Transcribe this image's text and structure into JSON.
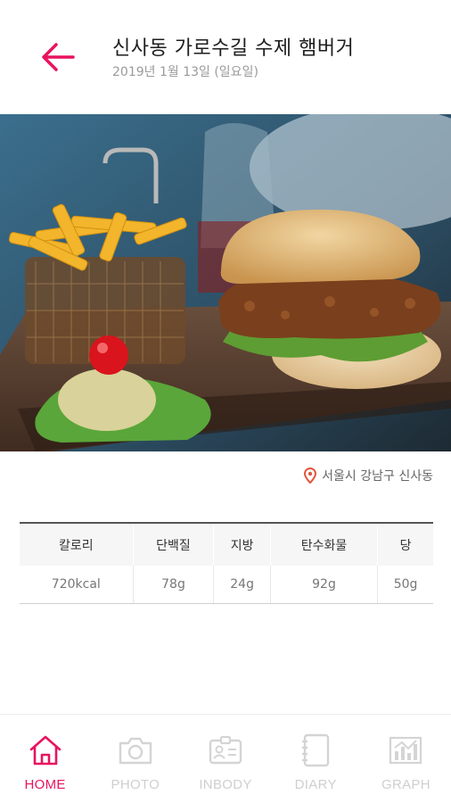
{
  "header": {
    "title": "신사동 가로수길 수제 햄버거",
    "date": "2019년 1월 13일 (일요일)"
  },
  "photo": {
    "description_icon": "burger-photo"
  },
  "location": {
    "text": "서울시 강남구 신사동"
  },
  "nutrition": {
    "headers": [
      "칼로리",
      "단백질",
      "지방",
      "탄수화물",
      "당"
    ],
    "values": [
      "720kcal",
      "78g",
      "24g",
      "92g",
      "50g"
    ]
  },
  "nav": {
    "items": [
      {
        "label": "HOME",
        "icon": "home-icon",
        "active": true
      },
      {
        "label": "PHOTO",
        "icon": "camera-icon",
        "active": false
      },
      {
        "label": "INBODY",
        "icon": "id-card-icon",
        "active": false
      },
      {
        "label": "DIARY",
        "icon": "notebook-icon",
        "active": false
      },
      {
        "label": "GRAPH",
        "icon": "chart-icon",
        "active": false
      }
    ]
  },
  "colors": {
    "accent": "#e8135f",
    "inactive": "#cfcfcf"
  }
}
